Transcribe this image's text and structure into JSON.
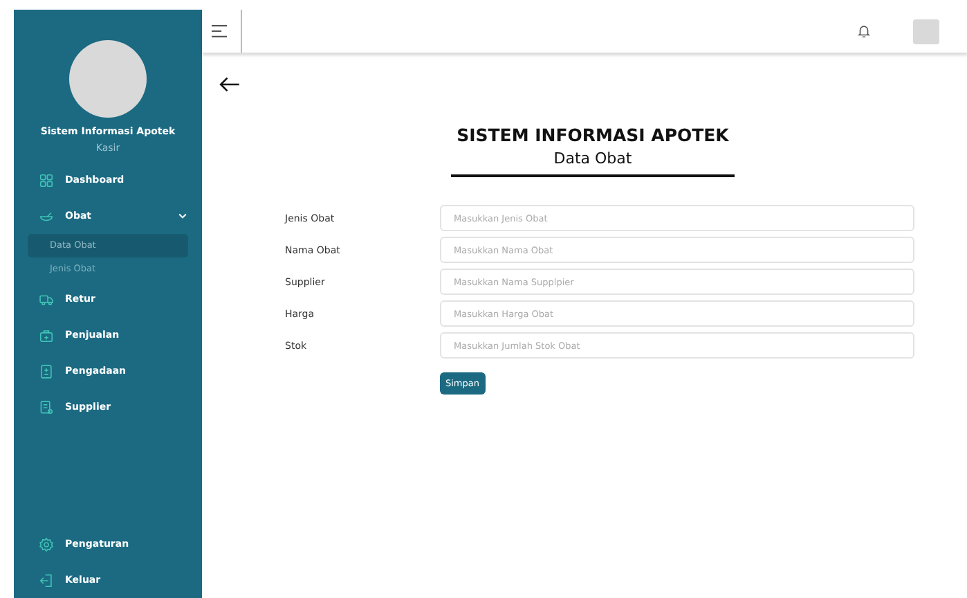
{
  "sidebar": {
    "app_name": "Sistem Informasi Apotek",
    "role": "Kasir",
    "items": [
      {
        "label": "Dashboard"
      },
      {
        "label": "Obat",
        "expanded": true,
        "children": [
          {
            "label": "Data Obat",
            "selected": true
          },
          {
            "label": "Jenis Obat",
            "selected": false
          }
        ]
      },
      {
        "label": "Retur"
      },
      {
        "label": "Penjualan"
      },
      {
        "label": "Pengadaan"
      },
      {
        "label": "Supplier"
      }
    ],
    "bottom_items": [
      {
        "label": "Pengaturan"
      },
      {
        "label": "Keluar"
      }
    ]
  },
  "page": {
    "title": "SISTEM INFORMASI APOTEK",
    "subtitle": "Data Obat"
  },
  "form": {
    "fields": [
      {
        "label": "Jenis Obat",
        "placeholder": "Masukkan Jenis Obat"
      },
      {
        "label": "Nama Obat",
        "placeholder": "Masukkan Nama Obat"
      },
      {
        "label": "Supplier",
        "placeholder": "Masukkan Nama Supplpier"
      },
      {
        "label": "Harga",
        "placeholder": "Masukkan Harga Obat"
      },
      {
        "label": "Stok",
        "placeholder": "Masukkan Jumlah Stok Obat"
      }
    ],
    "submit": "Simpan"
  }
}
